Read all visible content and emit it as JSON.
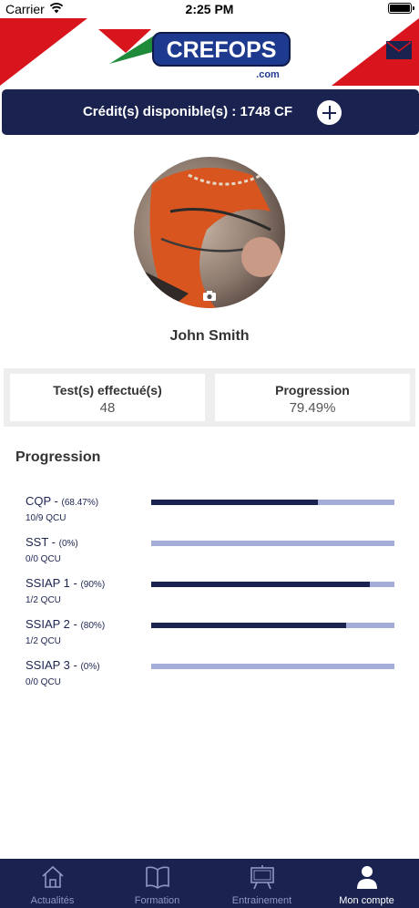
{
  "status_bar": {
    "carrier": "Carrier",
    "time": "2:25 PM"
  },
  "header": {
    "logo_text": "CREFOPS",
    "logo_suffix": ".com",
    "mail_icon": "envelope-icon"
  },
  "credit": {
    "label": "Crédit(s) disponible(s) : 1748 CF",
    "add_icon": "plus-circle-icon"
  },
  "profile": {
    "name": "John Smith",
    "camera_icon": "camera-icon"
  },
  "stats": [
    {
      "label": "Test(s) effectué(s)",
      "value": "48"
    },
    {
      "label": "Progression",
      "value": "79.49%"
    }
  ],
  "progression": {
    "title": "Progression",
    "items": [
      {
        "name": "CQP -",
        "percent_text": "(68.47%)",
        "qcu": "10/9 QCU",
        "fraction": 0.6847
      },
      {
        "name": "SST -",
        "percent_text": "(0%)",
        "qcu": "0/0 QCU",
        "fraction": 0
      },
      {
        "name": "SSIAP 1 -",
        "percent_text": "(90%)",
        "qcu": "1/2 QCU",
        "fraction": 0.9
      },
      {
        "name": "SSIAP 2 -",
        "percent_text": "(80%)",
        "qcu": "1/2 QCU",
        "fraction": 0.8
      },
      {
        "name": "SSIAP 3 -",
        "percent_text": "(0%)",
        "qcu": "0/0 QCU",
        "fraction": 0
      }
    ]
  },
  "tabs": [
    {
      "label": "Actualités",
      "icon": "house-icon",
      "active": false
    },
    {
      "label": "Formation",
      "icon": "book-icon",
      "active": false
    },
    {
      "label": "Entrainement",
      "icon": "easel-icon",
      "active": false
    },
    {
      "label": "Mon compte",
      "icon": "person-icon",
      "active": true
    }
  ],
  "colors": {
    "navy": "#1a2250",
    "red": "#d8141c",
    "track": "#a4acd8",
    "tab_inactive": "#8f97c2"
  }
}
